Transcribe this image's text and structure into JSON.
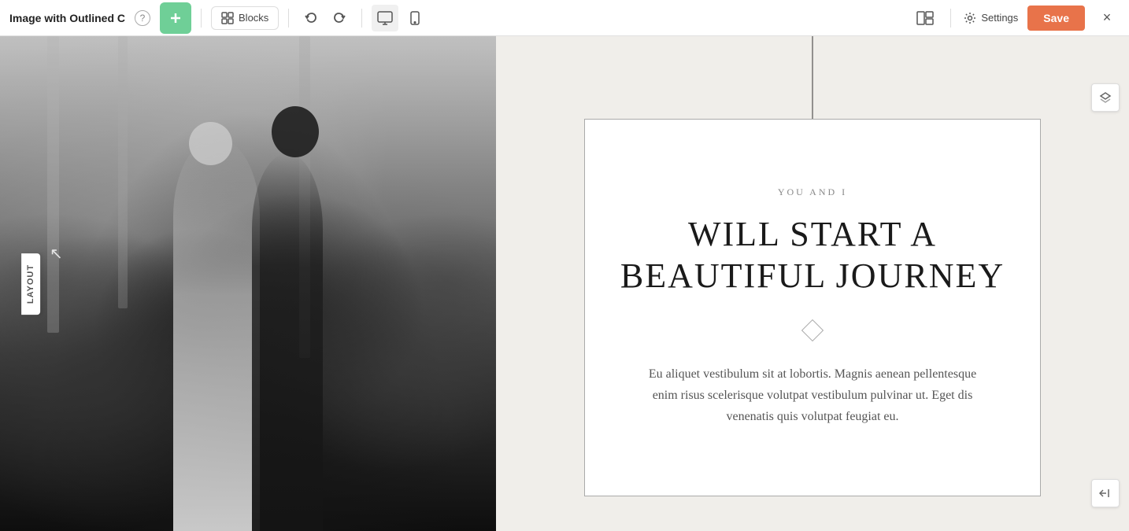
{
  "topbar": {
    "title": "Image with Outlined C",
    "help_label": "?",
    "add_label": "+",
    "blocks_label": "Blocks",
    "undo_icon": "undo-icon",
    "redo_icon": "redo-icon",
    "desktop_icon": "desktop-icon",
    "mobile_icon": "mobile-icon",
    "layout_icon": "layout-icon",
    "settings_label": "Settings",
    "save_label": "Save",
    "close_label": "×"
  },
  "layout_tab": {
    "label": "LAYOUT"
  },
  "content": {
    "subtitle": "YOU AND I",
    "title_line1": "WILL START A",
    "title_line2": "BEAUTIFUL JOURNEY",
    "body_text": "Eu aliquet vestibulum sit at lobortis. Magnis aenean pellentesque enim risus scelerisque volutpat vestibulum pulvinar ut. Eget dis venenatis quis volutpat feugiat eu."
  }
}
